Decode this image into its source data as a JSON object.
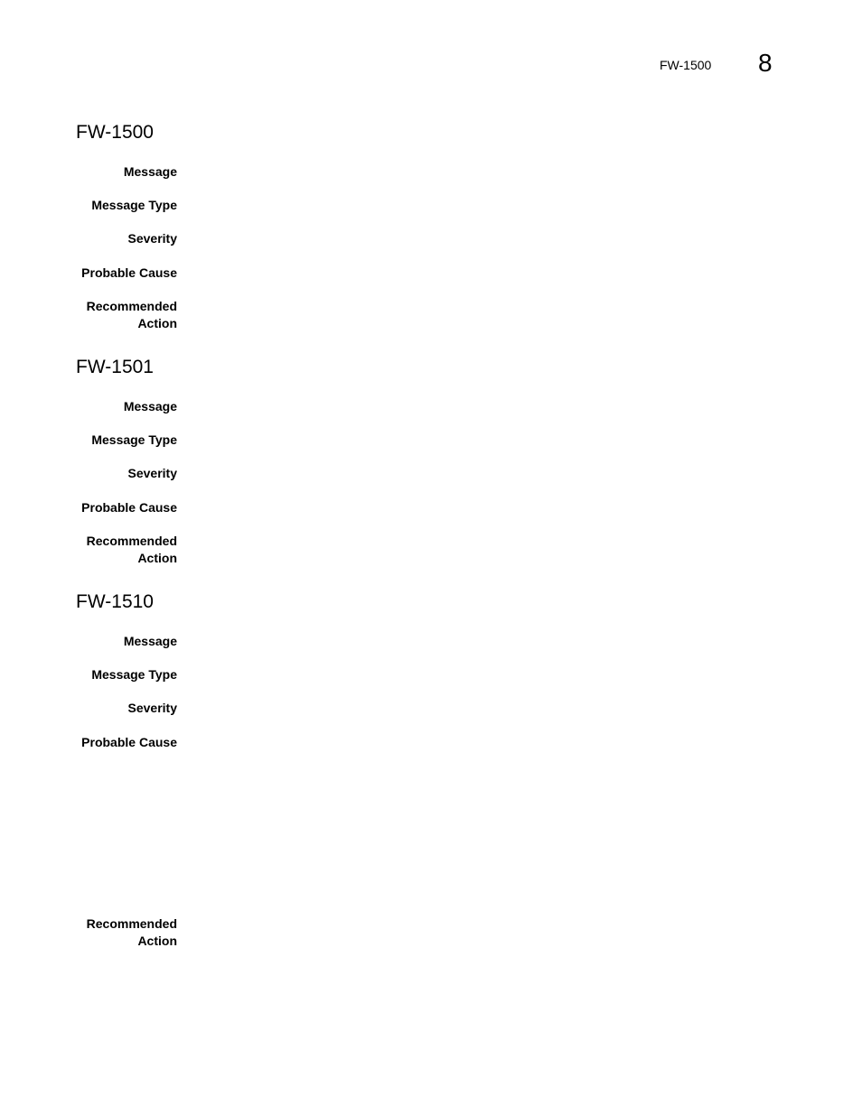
{
  "header": {
    "running_title": "FW-1500",
    "chapter_number": "8"
  },
  "sections": [
    {
      "title": "FW-1500",
      "fields": [
        {
          "label": "Message",
          "value": ""
        },
        {
          "label": "Message Type",
          "value": ""
        },
        {
          "label": "Severity",
          "value": ""
        },
        {
          "label": "Probable Cause",
          "value": ""
        },
        {
          "label": "Recommended\nAction",
          "label_lines": [
            "Recommended",
            "Action"
          ],
          "value": ""
        }
      ]
    },
    {
      "title": "FW-1501",
      "fields": [
        {
          "label": "Message",
          "value": ""
        },
        {
          "label": "Message Type",
          "value": ""
        },
        {
          "label": "Severity",
          "value": ""
        },
        {
          "label": "Probable Cause",
          "value": ""
        },
        {
          "label": "Recommended\nAction",
          "label_lines": [
            "Recommended",
            "Action"
          ],
          "value": ""
        }
      ]
    },
    {
      "title": "FW-1510",
      "fields": [
        {
          "label": "Message",
          "value": ""
        },
        {
          "label": "Message Type",
          "value": ""
        },
        {
          "label": "Severity",
          "value": ""
        },
        {
          "label": "Probable Cause",
          "value": ""
        },
        {
          "label": "Recommended\nAction",
          "label_lines": [
            "Recommended",
            "Action"
          ],
          "value": ""
        }
      ]
    }
  ]
}
